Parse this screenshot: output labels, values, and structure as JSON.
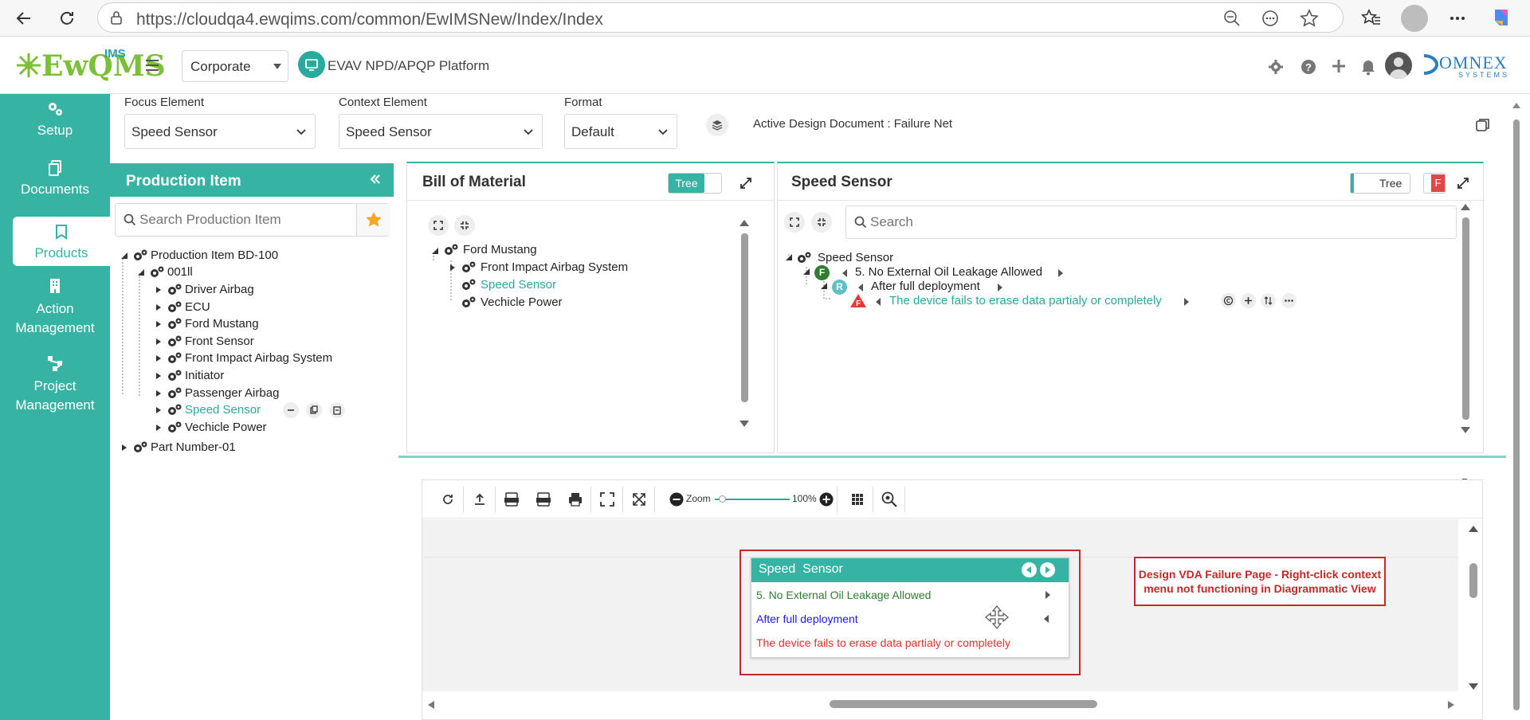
{
  "browser": {
    "url": "https://cloudqa4.ewqims.com/common/EwIMSNew/Index/Index"
  },
  "header": {
    "logo_main": "EwQMS",
    "logo_sup": "IMS",
    "company": "Corporate",
    "platform_title": "EVAV NPD/APQP Platform",
    "brand_right": "OMNEX",
    "brand_right_sub": "SYSTEMS"
  },
  "sidebar": {
    "items": [
      {
        "label": "Setup",
        "icon": "gears-icon"
      },
      {
        "label": "Documents",
        "icon": "documents-icon"
      },
      {
        "label": "Products",
        "icon": "products-icon"
      },
      {
        "label": "Action Management",
        "icon": "building-icon"
      },
      {
        "label": "Project Management",
        "icon": "network-icon"
      }
    ]
  },
  "toolbar": {
    "focus_label": "Focus Element",
    "focus_value": "Speed Sensor",
    "context_label": "Context Element",
    "context_value": "Speed Sensor",
    "format_label": "Format",
    "format_value": "Default",
    "active_doc": "Active Design Document : Failure Net"
  },
  "production": {
    "title": "Production Item",
    "search_placeholder": "Search Production Item",
    "root": "Production Item BD-100",
    "group": "001ll",
    "items": [
      "Driver Airbag",
      "ECU",
      "Ford Mustang",
      "Front Sensor",
      "Front Impact Airbag System",
      "Initiator",
      "Passenger Airbag",
      "Speed Sensor",
      "Vechicle Power"
    ],
    "selected": "Speed Sensor",
    "part": "Part Number-01"
  },
  "bom": {
    "title": "Bill of Material",
    "toggle": "Tree",
    "root": "Ford Mustang",
    "children": [
      "Front Impact Airbag System",
      "Speed Sensor",
      "Vechicle Power"
    ]
  },
  "sensor": {
    "title": "Speed Sensor",
    "toggle": "Tree",
    "f_badge": "F",
    "search_placeholder": "Search",
    "root": "Speed Sensor",
    "function": "5. No External Oil Leakage Allowed",
    "requirement": "After full deployment",
    "failure": "The device fails to erase data partialy or completely",
    "badge_f": "F",
    "badge_r": "R"
  },
  "diagram": {
    "zoom_label": "Zoom",
    "zoom_value": "100%",
    "zoom_level": 0.1,
    "node_title": "Speed  Sensor",
    "node_function": "5. No External Oil Leakage Allowed",
    "node_requirement": "After full deployment",
    "node_failure": "The device fails to erase data partialy or completely",
    "note": "Design VDA Failure Page - Right-click context menu not functioning in Diagrammatic View"
  },
  "colors": {
    "teal": "#37b3a4",
    "green_text": "#2e7d32",
    "blue_text": "#1a1ae0",
    "red_text": "#e03030",
    "annotation_red": "#c62828"
  }
}
